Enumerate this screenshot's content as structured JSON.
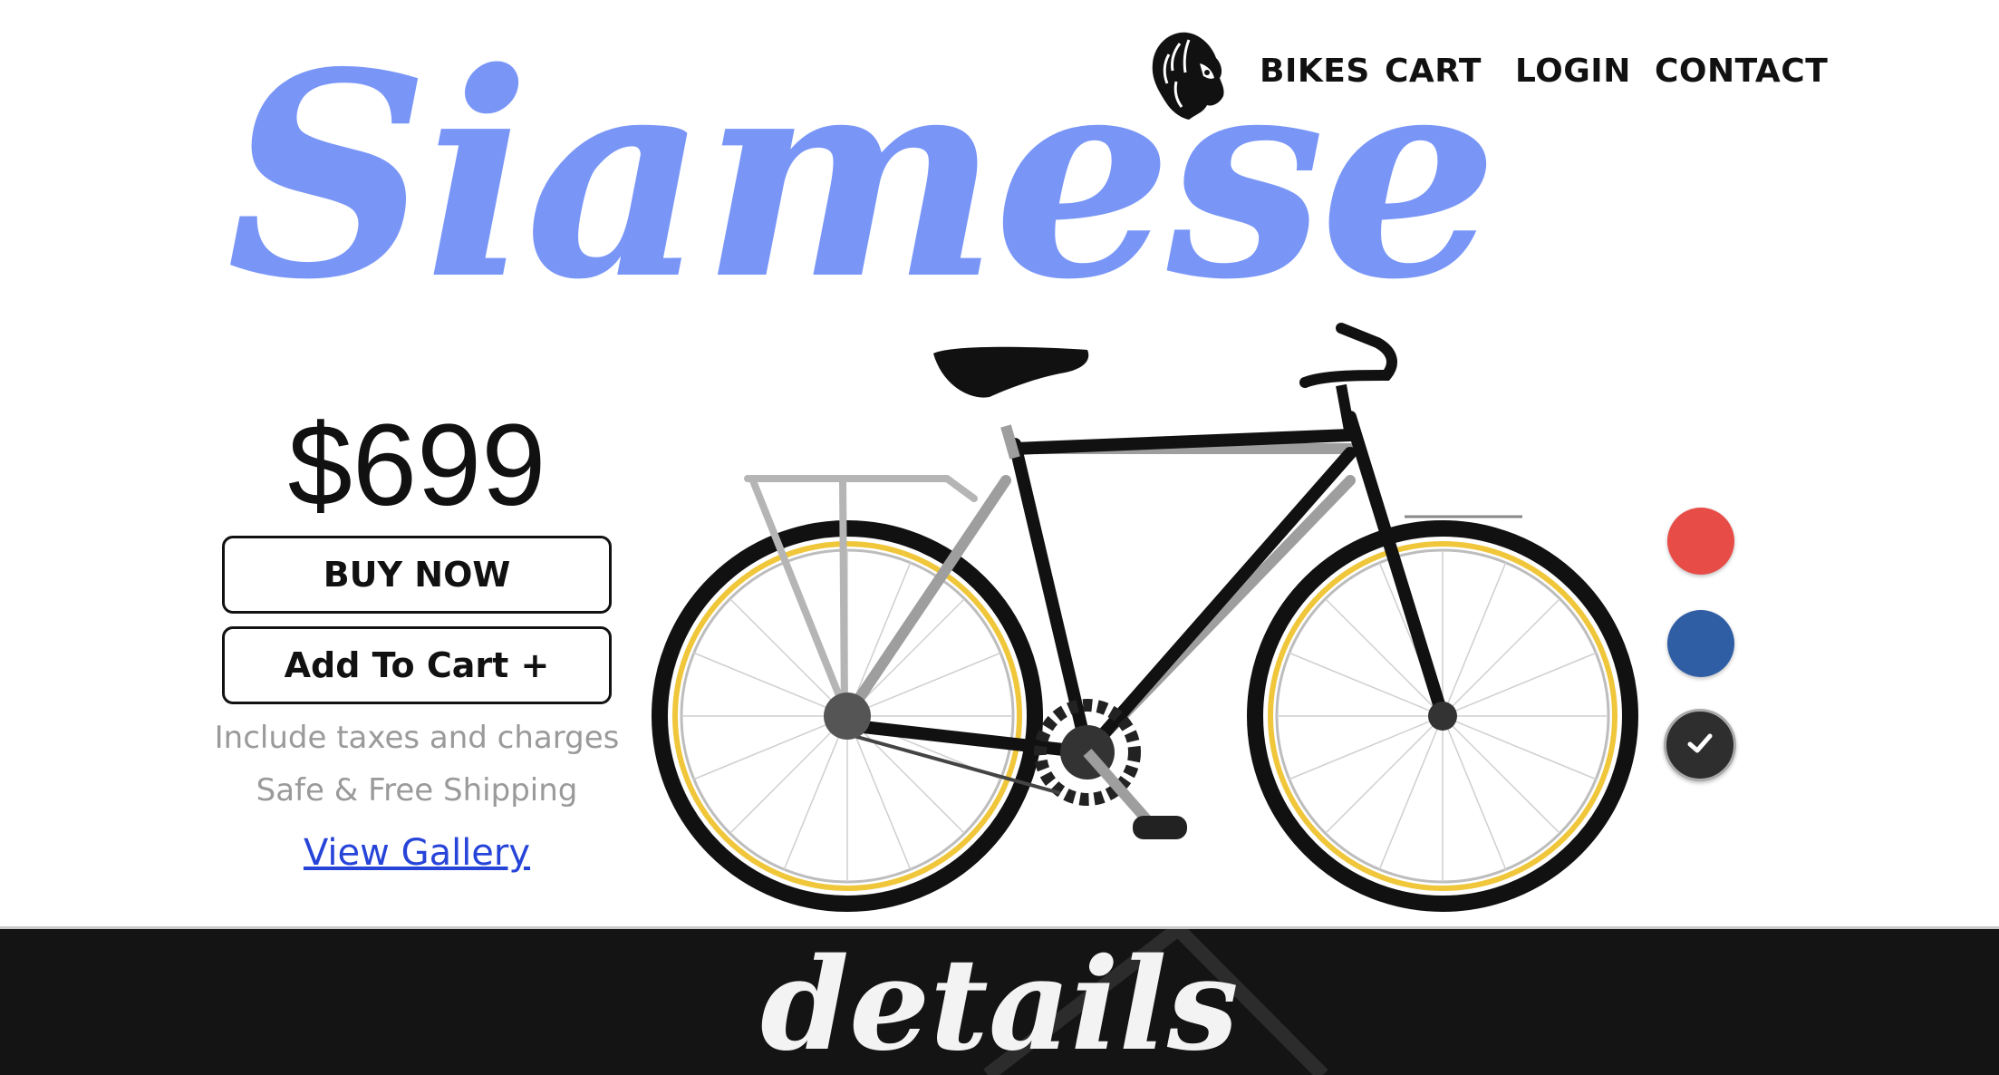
{
  "nav": {
    "logo_icon": "lion-head-icon",
    "links": [
      "BIKES",
      "CART",
      "LOGIN",
      "CONTACT"
    ]
  },
  "product": {
    "name": "Siamese",
    "price": "$699",
    "buy_label": "BUY NOW",
    "cart_label": "Add To Cart +",
    "note_taxes": "Include taxes and charges",
    "note_shipping": "Safe & Free Shipping",
    "gallery_label": "View Gallery",
    "image_icon": "bicycle-image"
  },
  "colors": {
    "options": [
      "#e84c47",
      "#2f5ea5",
      "#2e2e2e"
    ],
    "selected_index": 2,
    "selected_icon": "checkmark-icon",
    "title_color": "#6f8ff7"
  },
  "footer": {
    "title": "details"
  }
}
